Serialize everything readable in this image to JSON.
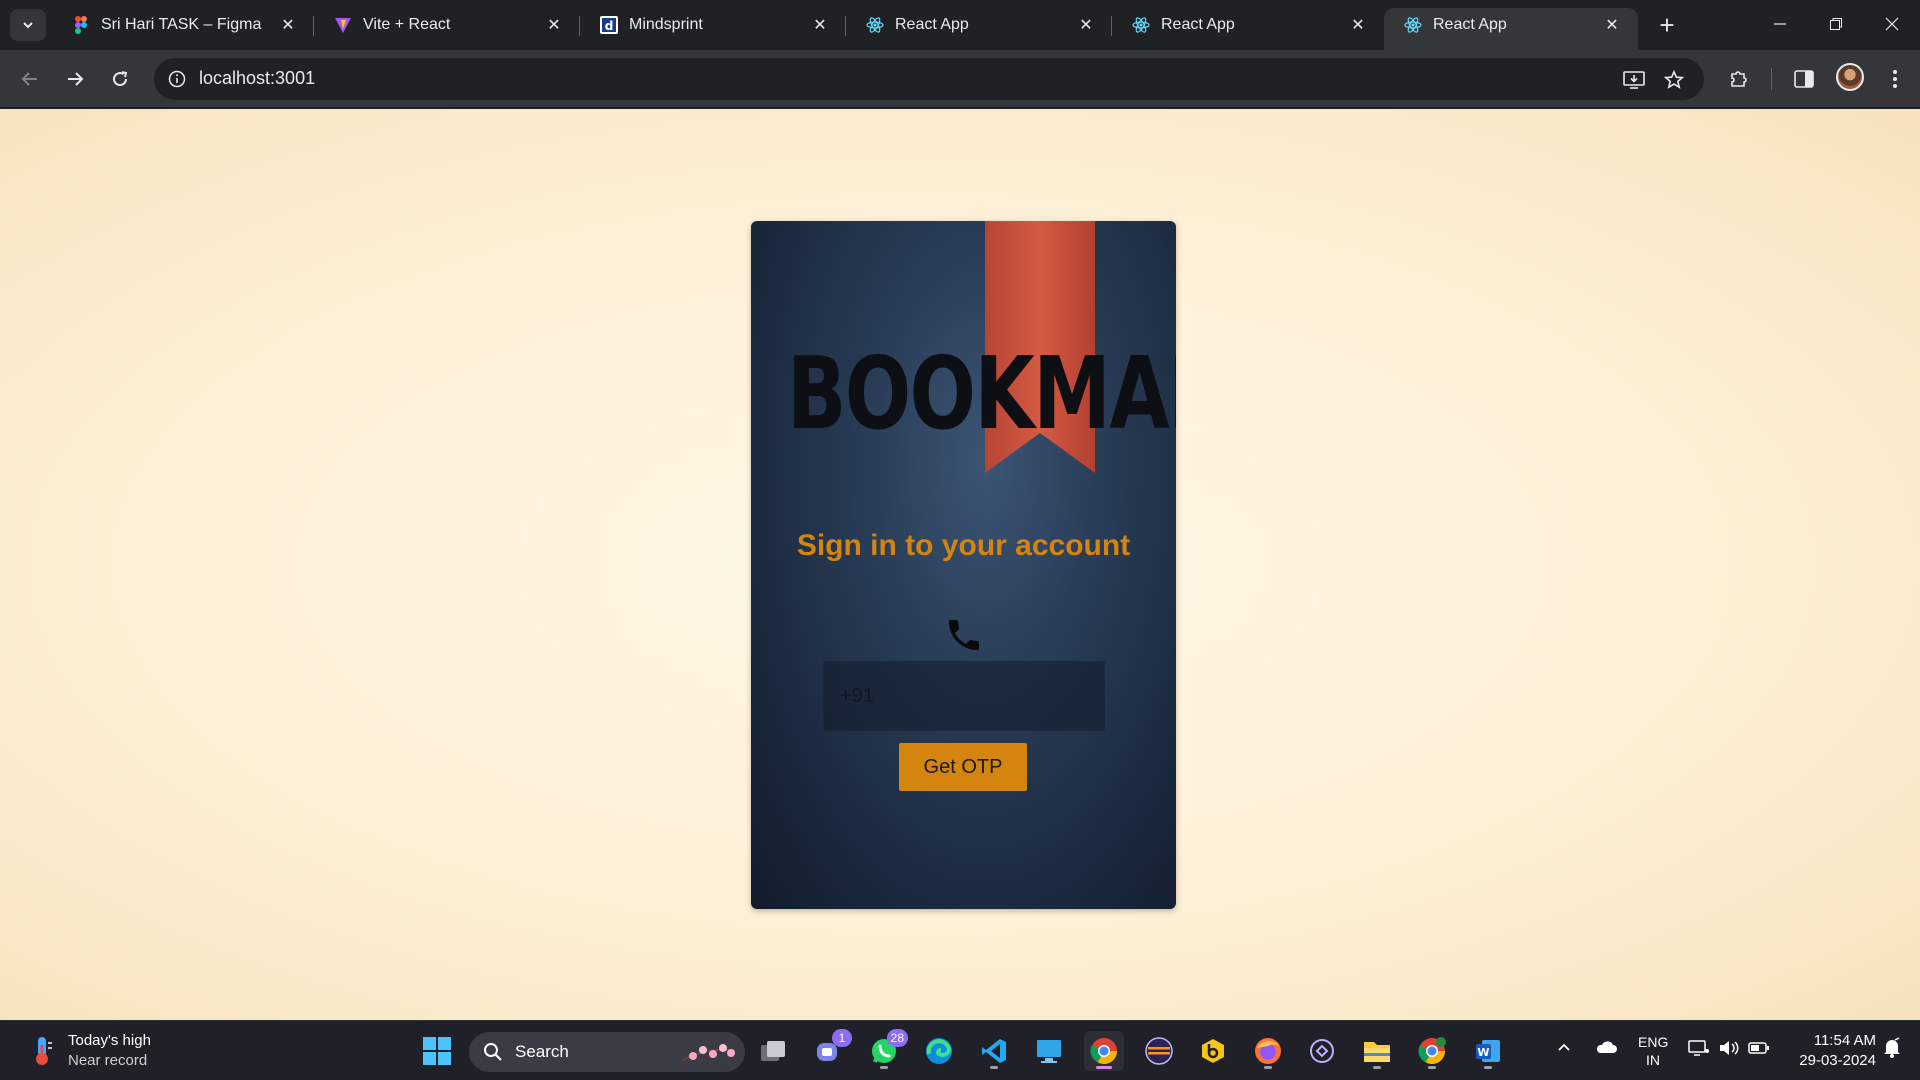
{
  "browser": {
    "tabs": [
      {
        "title": "Sri Hari TASK – Figma",
        "icon": "figma-icon",
        "active": false
      },
      {
        "title": "Vite + React",
        "icon": "vite-icon",
        "active": false
      },
      {
        "title": "Mindsprint",
        "icon": "mindsprint-icon",
        "active": false
      },
      {
        "title": "React App",
        "icon": "react-icon",
        "active": false
      },
      {
        "title": "React App",
        "icon": "react-icon",
        "active": false
      },
      {
        "title": "React App",
        "icon": "react-icon",
        "active": true
      }
    ],
    "address": "localhost:3001"
  },
  "page": {
    "logo": {
      "text": "BOOKMARK"
    },
    "heading": "Sign in to your account",
    "phone_placeholder": "+91",
    "otp_button": "Get OTP",
    "colors": {
      "accent": "#d4850f",
      "ribbon": "#c9523d",
      "card": "#233650",
      "background": "#fdf2dc"
    }
  },
  "taskbar": {
    "weather": {
      "line1": "Today's high",
      "line2": "Near record"
    },
    "search_label": "Search",
    "apps": [
      {
        "name": "task-view-icon"
      },
      {
        "name": "teams-icon",
        "badge": "1"
      },
      {
        "name": "whatsapp-icon",
        "badge": "28"
      },
      {
        "name": "edge-icon"
      },
      {
        "name": "vscode-icon"
      },
      {
        "name": "remote-desktop-icon"
      },
      {
        "name": "chrome-icon",
        "active": true
      },
      {
        "name": "eclipse-icon"
      },
      {
        "name": "bbs-icon"
      },
      {
        "name": "firefox-icon"
      },
      {
        "name": "settings-app-icon"
      },
      {
        "name": "file-explorer-icon"
      },
      {
        "name": "chrome-profile-icon"
      },
      {
        "name": "word-icon"
      }
    ],
    "language": {
      "line1": "ENG",
      "line2": "IN"
    },
    "time": "11:54 AM",
    "date": "29-03-2024"
  }
}
